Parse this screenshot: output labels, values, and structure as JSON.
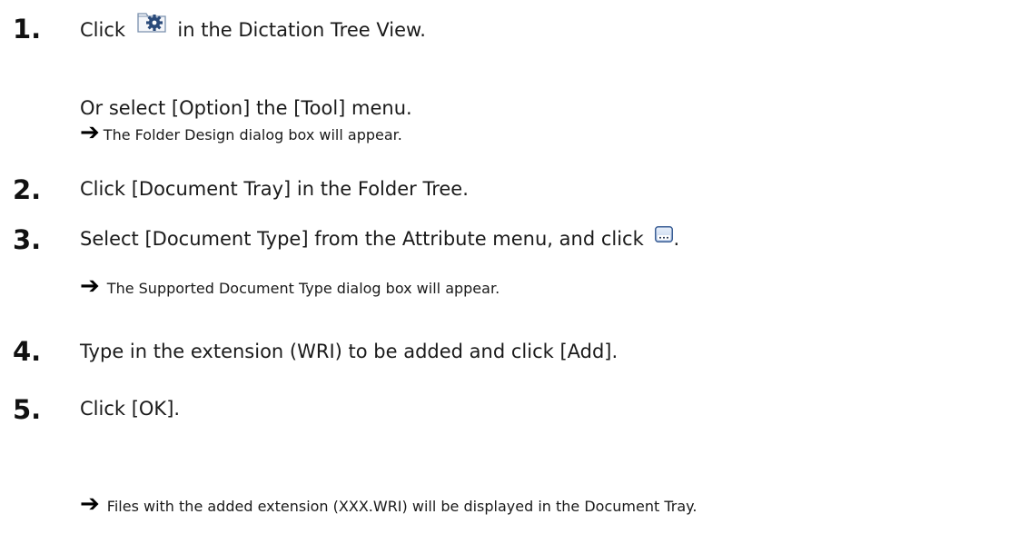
{
  "steps": [
    {
      "number": "1.",
      "text_before_icon": "Click",
      "icon": "folder-design-gear-icon",
      "text_after_icon": "in the Dictation Tree View.",
      "sub_text": "Or select [Option] the [Tool] menu.",
      "result": "The Folder Design dialog box will appear."
    },
    {
      "number": "2.",
      "text": "Click [Document Tray] in the Folder Tree."
    },
    {
      "number": "3.",
      "text_before_icon": "Select [Document Type] from the Attribute menu, and click",
      "icon": "ellipsis-button-icon",
      "text_after_icon": ".",
      "result": "The Supported Document Type dialog box will appear."
    },
    {
      "number": "4.",
      "text": "Type in the extension (WRI) to be added and click [Add]."
    },
    {
      "number": "5.",
      "text": "Click [OK].",
      "result": "Files with the added extension (XXX.WRI) will be displayed in the Document Tray."
    }
  ],
  "arrow_icon": "right-arrow-icon"
}
